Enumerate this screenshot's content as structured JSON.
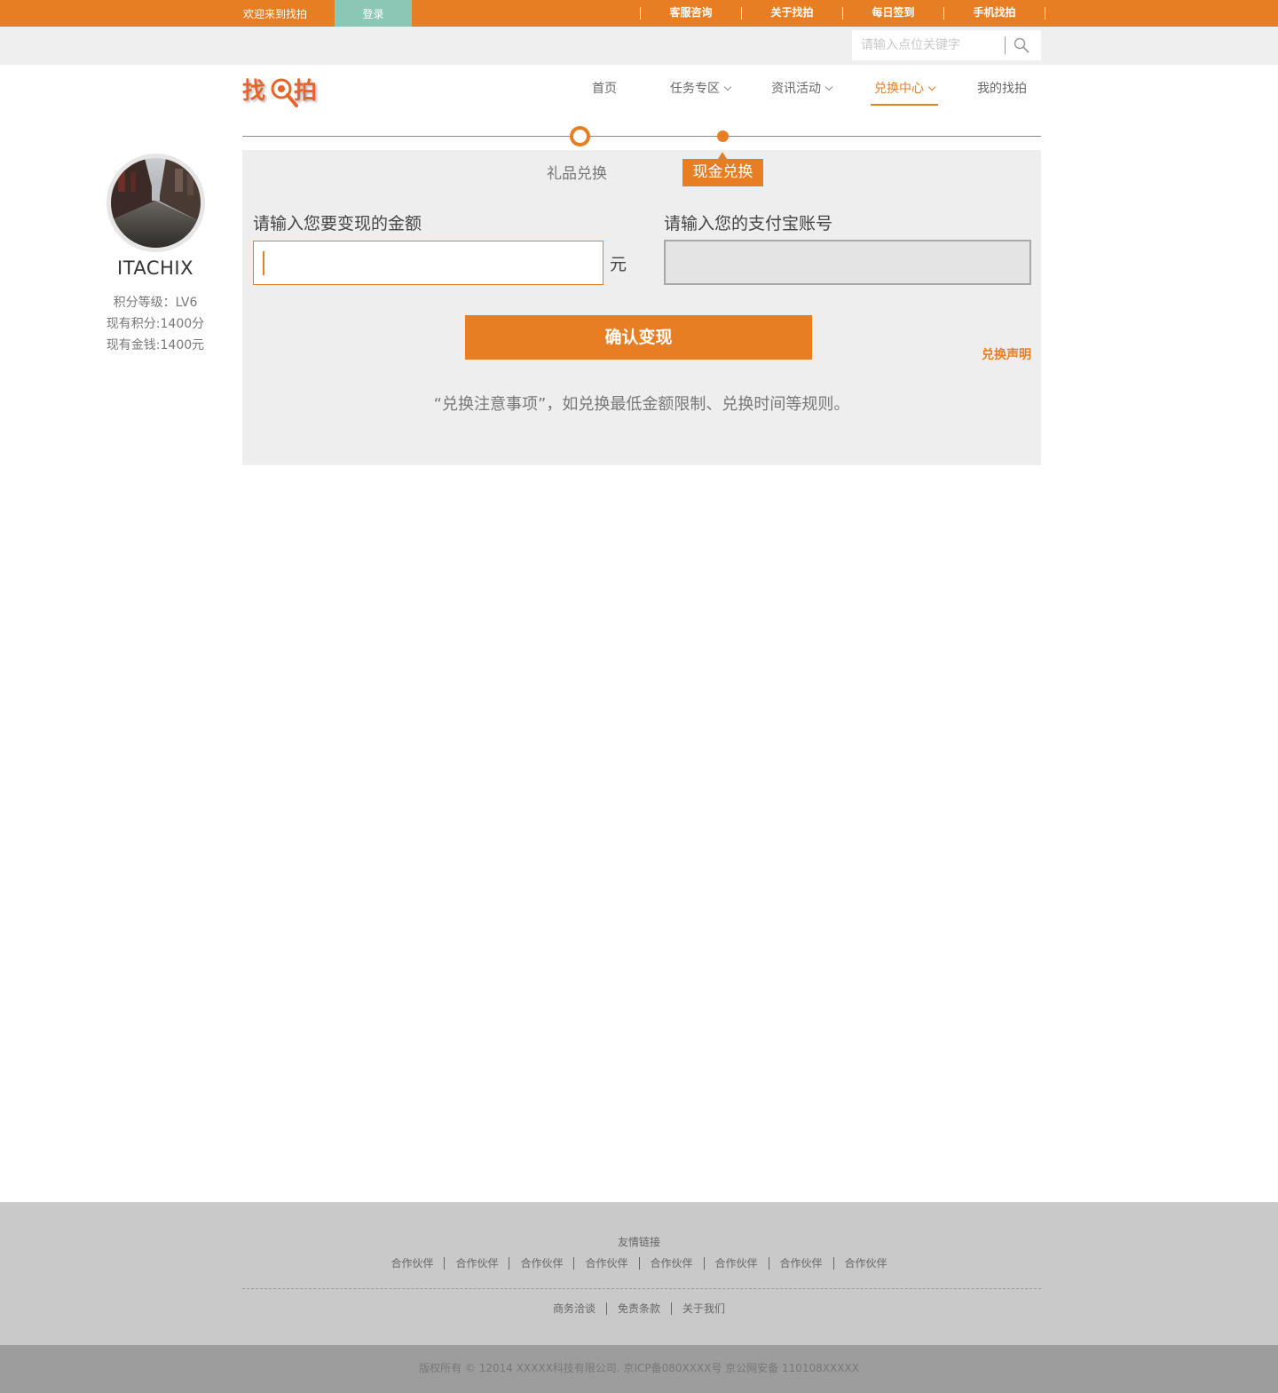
{
  "topbar": {
    "welcome": "欢迎来到找拍",
    "login": "登录",
    "links": [
      "客服咨询",
      "关于找拍",
      "每日签到",
      "手机找拍"
    ]
  },
  "search": {
    "placeholder": "请输入点位关键字"
  },
  "logo": {
    "left": "找",
    "right": "拍"
  },
  "nav": {
    "home": "首页",
    "tasks": "任务专区",
    "news": "资讯活动",
    "exchange": "兑换中心",
    "mine": "我的找拍"
  },
  "profile": {
    "username": "ITACHIX",
    "level": "积分等级：LV6",
    "points": "现有积分:1400分",
    "money": "现有金钱:1400元"
  },
  "exchange": {
    "tab_gift": "礼品兑换",
    "tab_cash": "现金兑换",
    "amount_label": "请输入您要变现的金额",
    "amount_unit": "元",
    "alipay_label": "请输入您的支付宝账号",
    "confirm": "确认变现",
    "declaration": "兑换声明",
    "notice": "“兑换注意事项”，如兑换最低金额限制、兑换时间等规则。"
  },
  "footer": {
    "friend_links_title": "友情链接",
    "partners": [
      "合作伙伴",
      "合作伙伴",
      "合作伙伴",
      "合作伙伴",
      "合作伙伴",
      "合作伙伴",
      "合作伙伴",
      "合作伙伴"
    ],
    "bottom_links": [
      "商务洽谈",
      "免责条款",
      "关于我们"
    ],
    "copyright": "版权所有 © 12014 XXXXX科技有限公司. 京ICP备080XXXX号 京公网安备 110108XXXXX"
  },
  "colors": {
    "accent": "#e87e23",
    "login_bg": "#8cc7b6",
    "panel_bg": "#eeeeee",
    "footer_bg": "#c9c9c9",
    "copyright_bg": "#9d9d9d"
  }
}
